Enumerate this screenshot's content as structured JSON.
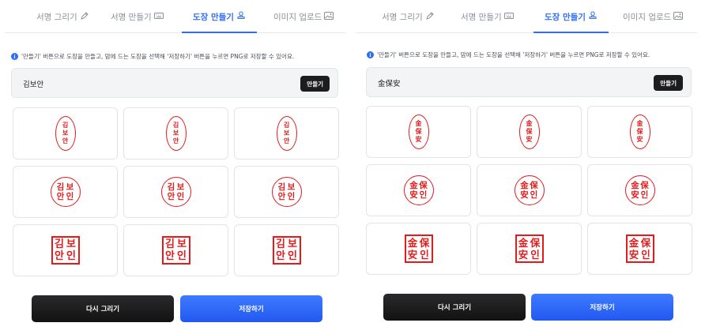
{
  "tabs": [
    {
      "label": "서명 그리기",
      "icon": "pen-icon"
    },
    {
      "label": "서명 만들기",
      "icon": "keyboard-icon"
    },
    {
      "label": "도장 만들기",
      "icon": "stamp-icon"
    },
    {
      "label": "이미지 업로드",
      "icon": "image-upload-icon"
    }
  ],
  "active_tab": "도장 만들기",
  "info_text": "'만들기' 버튼으로 도장을 만들고, 맘에 드는 도장을 선택해 '저장하기' 버튼을 누르면 PNG로 저장할 수 있어요.",
  "make_button": "만들기",
  "redraw_button": "다시 그리기",
  "save_button": "저장하기",
  "accent_color": "#2f6df6",
  "stamp_color": "#e31b1b",
  "panels": [
    {
      "name_value": "김보안",
      "chars": [
        "김",
        "보",
        "안",
        "인"
      ]
    },
    {
      "name_value": "金保安",
      "chars": [
        "金",
        "保",
        "安",
        "인"
      ]
    }
  ],
  "stamp_styles": [
    "oval",
    "circle",
    "square"
  ]
}
